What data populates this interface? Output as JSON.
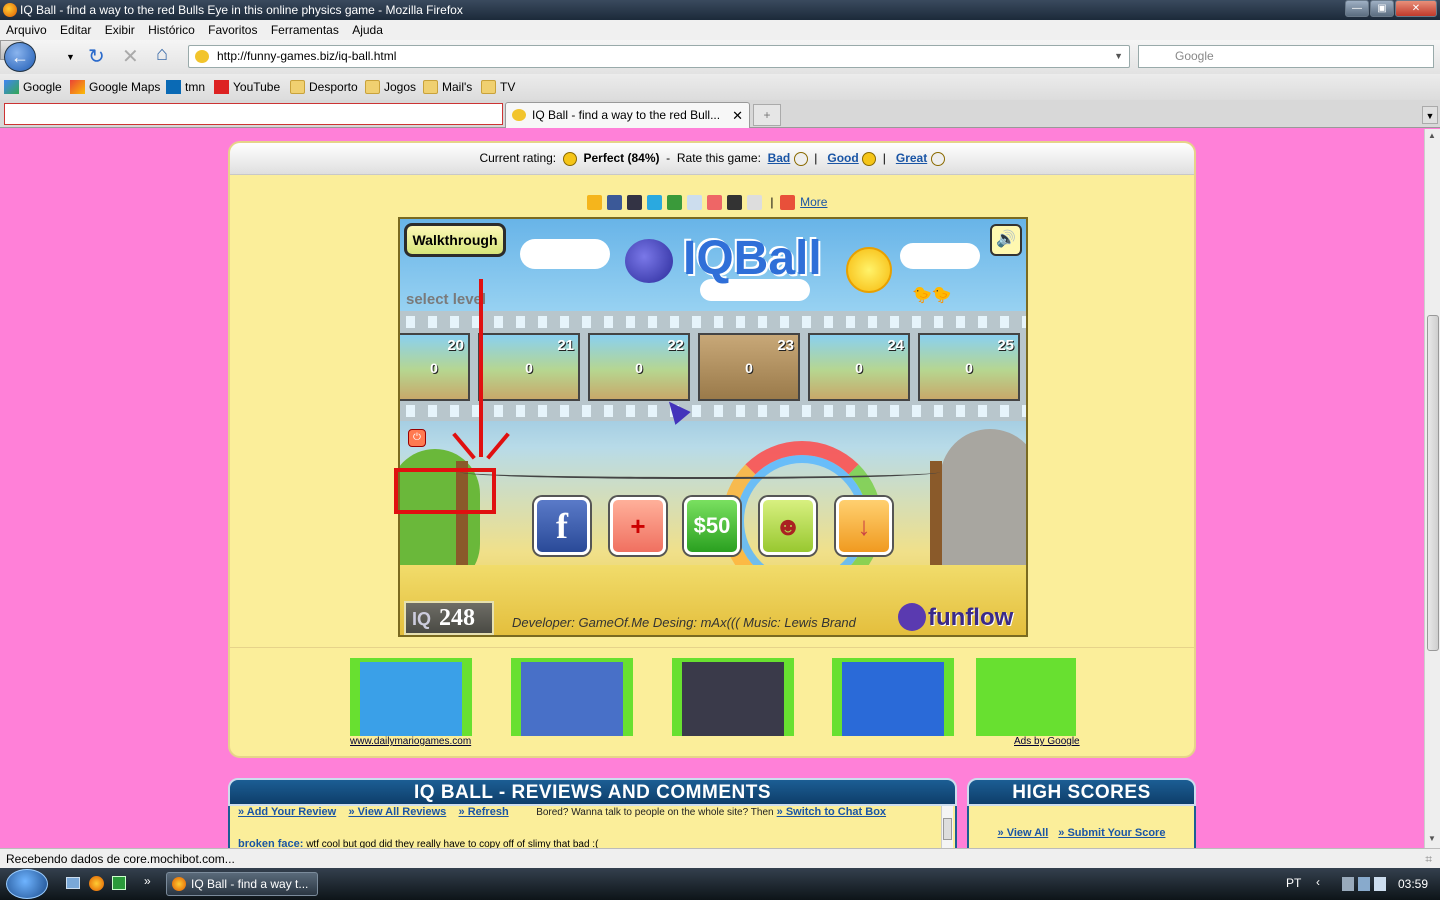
{
  "window": {
    "title": "IQ Ball - find a way to the red Bulls Eye in this online physics game - Mozilla Firefox"
  },
  "menu": [
    "Arquivo",
    "Editar",
    "Exibir",
    "Histórico",
    "Favoritos",
    "Ferramentas",
    "Ajuda"
  ],
  "nav": {
    "url": "http://funny-games.biz/iq-ball.html",
    "search_placeholder": "Google"
  },
  "bookmarks": [
    "Google",
    "Google Maps",
    "tmn",
    "YouTube",
    "Desporto",
    "Jogos",
    "Mail's",
    "TV"
  ],
  "tabs": [
    {
      "label": "IQ Ball - find a way to the red Bull..."
    }
  ],
  "rating": {
    "current_label": "Current rating:",
    "current_value": "Perfect (84%)",
    "rate_label": "Rate this game:",
    "bad": "Bad",
    "good": "Good",
    "great": "Great"
  },
  "share": {
    "more": "More"
  },
  "game": {
    "walkthrough": "Walkthrough",
    "logo": "IQBall",
    "select_level": "select level",
    "levels": [
      {
        "num": "20",
        "score": "0"
      },
      {
        "num": "21",
        "score": "0"
      },
      {
        "num": "22",
        "score": "0"
      },
      {
        "num": "23",
        "score": "0"
      },
      {
        "num": "24",
        "score": "0"
      },
      {
        "num": "25",
        "score": "0"
      }
    ],
    "buttons": [
      "f",
      "+",
      "$50",
      "☻",
      "↓"
    ],
    "iq_score": "248",
    "iq_label": "IQ",
    "credits": "Developer: GameOf.Me   Desing: mAx(((   Music: Lewis Brand",
    "brand": "funflow"
  },
  "ads": {
    "site": "www.dailymariogames.com",
    "by": "Ads by Google"
  },
  "reviews": {
    "title": "IQ BALL - REVIEWS AND COMMENTS",
    "add": "» Add Your Review",
    "view": "» View All Reviews",
    "refresh": "» Refresh",
    "bored": "Bored? Wanna talk to people on the whole site? Then",
    "chat": "» Switch to Chat Box",
    "comment_user": "broken face:",
    "comment_text": "wtf cool but god did they really have to copy off of slimy that bad :("
  },
  "highscores": {
    "title": "HIGH SCORES",
    "view_all": "» View All",
    "submit": "» Submit Your Score"
  },
  "status": "Recebendo dados de core.mochibot.com...",
  "taskbar": {
    "task": "IQ Ball - find a way t...",
    "lang": "PT",
    "clock": "03:59"
  }
}
